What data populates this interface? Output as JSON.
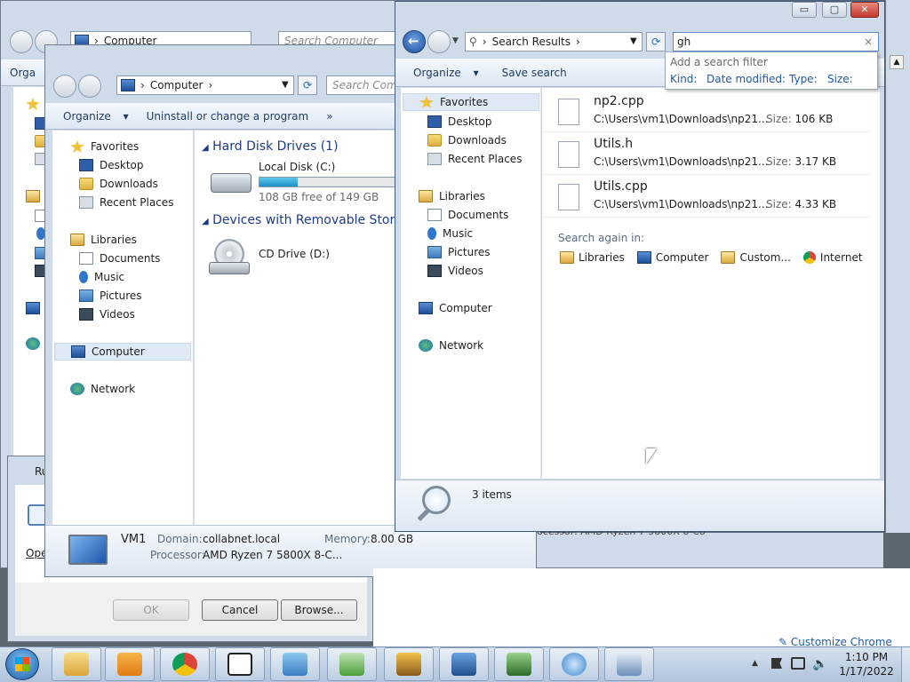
{
  "bg_window": {
    "address": "Computer",
    "search_placeholder": "Search Computer",
    "toolbar_partial": "Orga",
    "status_partial": "ocessor: AMD Ryzen 7 5800X 8-Co"
  },
  "run_dialog": {
    "title_partial": "Ru",
    "open_partial": "Ope",
    "ok_label": "OK",
    "cancel_label": "Cancel",
    "browse_label": "Browse..."
  },
  "computer_window": {
    "address": "Computer",
    "search_placeholder": "Search Compu",
    "toolbar": {
      "organize": "Organize",
      "uninstall": "Uninstall or change a program",
      "more": "»"
    },
    "nav": {
      "favorites": "Favorites",
      "desktop": "Desktop",
      "downloads": "Downloads",
      "recent": "Recent Places",
      "libraries": "Libraries",
      "documents": "Documents",
      "music": "Music",
      "pictures": "Pictures",
      "videos": "Videos",
      "computer": "Computer",
      "network": "Network"
    },
    "groups": {
      "hdd": "Hard Disk Drives (1)",
      "removable": "Devices with Removable Storag"
    },
    "drives": {
      "c_name": "Local Disk (C:)",
      "c_free": "108 GB free of 149 GB",
      "c_used_fraction": 0.275,
      "d_name": "CD Drive (D:)"
    },
    "details": {
      "name": "VM1",
      "domain_label": "Domain:",
      "domain_value": "collabnet.local",
      "memory_label": "Memory:",
      "memory_value": "8.00 GB",
      "processor_label": "Processor:",
      "processor_value": "AMD Ryzen 7 5800X 8-C..."
    }
  },
  "search_window": {
    "address": "Search Results",
    "query": "gh",
    "filter": {
      "header": "Add a search filter",
      "kind": "Kind:",
      "date": "Date modified:",
      "type": "Type:",
      "size": "Size:"
    },
    "toolbar": {
      "organize": "Organize",
      "save_search": "Save search"
    },
    "nav": {
      "favorites": "Favorites",
      "desktop": "Desktop",
      "downloads": "Downloads",
      "recent": "Recent Places",
      "libraries": "Libraries",
      "documents": "Documents",
      "music": "Music",
      "pictures": "Pictures",
      "videos": "Videos",
      "computer": "Computer",
      "network": "Network"
    },
    "results": [
      {
        "name": "np2.cpp",
        "path": "C:\\Users\\vm1\\Downloads\\np21...",
        "size_label": "Size:",
        "size": "106 KB"
      },
      {
        "name": "Utils.h",
        "path": "C:\\Users\\vm1\\Downloads\\np21...",
        "size_label": "Size:",
        "size": "3.17 KB"
      },
      {
        "name": "Utils.cpp",
        "path": "C:\\Users\\vm1\\Downloads\\np21...",
        "size_label": "Size:",
        "size": "4.33 KB"
      }
    ],
    "search_again": {
      "label": "Search again in:",
      "libraries": "Libraries",
      "computer": "Computer",
      "custom": "Custom...",
      "internet": "Internet"
    },
    "status": "3 items",
    "window_buttons": {
      "min": "▭",
      "max": "▢",
      "close": "✕"
    }
  },
  "desktop": {
    "customize_chrome": "Customize Chrome"
  },
  "taskbar": {
    "time": "1:10 PM",
    "date": "1/17/2022",
    "tray_up": "▲",
    "apps": [
      "explorer",
      "media-player",
      "chrome",
      "7zip",
      "control-panel",
      "installer",
      "network-tool",
      "server-tool",
      "task-manager",
      "sync-tool",
      "remote-desktop"
    ]
  },
  "colors": {
    "accent": "#1e4fa0",
    "close_red": "#c94436",
    "link": "#1f5aa6",
    "progress": "#2aa5d8"
  }
}
